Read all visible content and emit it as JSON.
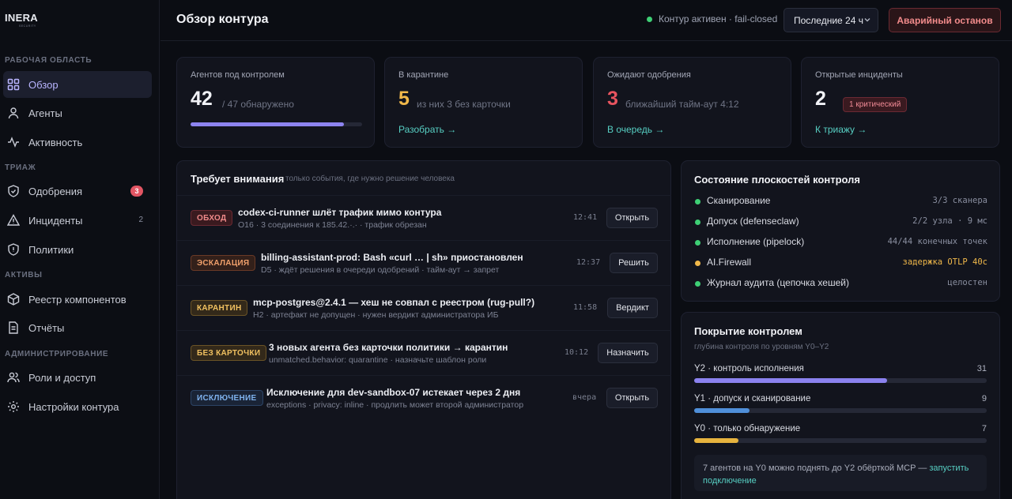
{
  "brand": {
    "name": "INERA",
    "sub": "SECURITY"
  },
  "sidebar": {
    "sections": [
      {
        "label": "РАБОЧАЯ ОБЛАСТЬ"
      },
      {
        "label": "ТРИАЖ"
      },
      {
        "label": "АКТИВЫ"
      },
      {
        "label": "АДМИНИСТРИРОВАНИЕ"
      }
    ],
    "items": [
      {
        "label": "Обзор",
        "icon": "grid-icon"
      },
      {
        "label": "Агенты",
        "icon": "user-icon"
      },
      {
        "label": "Активность",
        "icon": "pulse-icon"
      },
      {
        "label": "Одобрения",
        "icon": "shield-check-icon",
        "badge": "3"
      },
      {
        "label": "Инциденты",
        "icon": "warning-icon",
        "count": "2"
      },
      {
        "label": "Политики",
        "icon": "shield-icon"
      },
      {
        "label": "Реестр компонентов",
        "icon": "cube-icon"
      },
      {
        "label": "Отчёты",
        "icon": "document-icon"
      },
      {
        "label": "Роли и доступ",
        "icon": "users-icon"
      },
      {
        "label": "Настройки контура",
        "icon": "gear-icon"
      }
    ]
  },
  "header": {
    "title": "Обзор контура",
    "status": "Контур активен · fail-closed",
    "range": "Последние 24 ч",
    "stop_label": "Аварийный останов"
  },
  "stats": [
    {
      "label": "Агентов под контролем",
      "value": "42",
      "sub": "/ 47 обнаружено",
      "progress": 0.894,
      "color": "#f1f2f6"
    },
    {
      "label": "В карантине",
      "value": "5",
      "sub": "из них 3 без карточки",
      "link": "Разобрать →",
      "color": "#f0b84a"
    },
    {
      "label": "Ожидают одобрения",
      "value": "3",
      "sub": "ближайший тайм-аут 4:12",
      "link": "В очередь →",
      "color": "#e8545f"
    },
    {
      "label": "Открытые инциденты",
      "value": "2",
      "badge": "1 критический",
      "link": "К триажу →",
      "color": "#f1f2f6"
    }
  ],
  "attention": {
    "title": "Требует внимания",
    "subtitle": "только события, где нужно решение человека",
    "rows": [
      {
        "tag": "ОБХОД",
        "title": "codex-ci-runner шлёт трафик мимо контура",
        "desc": "O16 · 3 соединения к 185.42.·.· · трафик обрезан",
        "time": "12:41",
        "action": "Открыть"
      },
      {
        "tag": "ЭСКАЛАЦИЯ",
        "title": "billing-assistant-prod: Bash «curl … | sh» приостановлен",
        "desc": "D5 · ждёт решения в очереди одобрений · тайм-аут → запрет",
        "time": "12:37",
        "action": "Решить"
      },
      {
        "tag": "КАРАНТИН",
        "title": "mcp-postgres@2.4.1 — хеш не совпал с реестром (rug-pull?)",
        "desc": "H2 · артефакт не допущен · нужен вердикт администратора ИБ",
        "time": "11:58",
        "action": "Вердикт"
      },
      {
        "tag": "БЕЗ КАРТОЧКИ",
        "title": "3 новых агента без карточки политики → карантин",
        "desc": "unmatched.behavior: quarantine · назначьте шаблон роли",
        "time": "10:12",
        "action": "Назначить"
      },
      {
        "tag": "ИСКЛЮЧЕНИЕ",
        "title": "Исключение для dev-sandbox-07 истекает через 2 дня",
        "desc": "exceptions · privacy: inline · продлить может второй администратор",
        "time": "вчера",
        "action": "Открыть"
      }
    ]
  },
  "planes": {
    "title": "Состояние плоскостей контроля",
    "rows": [
      {
        "name": "Сканирование",
        "value": "3/3 сканера",
        "status": "ok"
      },
      {
        "name": "Допуск (defenseclaw)",
        "value": "2/2 узла · 9 мс",
        "status": "ok"
      },
      {
        "name": "Исполнение (pipelock)",
        "value": "44/44 конечных точек",
        "status": "ok"
      },
      {
        "name": "AI.Firewall",
        "value": "задержка OTLP 40с",
        "status": "warn"
      },
      {
        "name": "Журнал аудита (цепочка хешей)",
        "value": "целостен",
        "status": "ok"
      }
    ]
  },
  "coverage": {
    "title": "Покрытие контролем",
    "subtitle": "глубина контроля по уровням Y0–Y2",
    "rows": [
      {
        "name": "Y2 · контроль исполнения",
        "value": "31",
        "fraction": 0.66,
        "color": "#8b82ef"
      },
      {
        "name": "Y1 · допуск и сканирование",
        "value": "9",
        "fraction": 0.19,
        "color": "#4f8fd9"
      },
      {
        "name": "Y0 · только обнаружение",
        "value": "7",
        "fraction": 0.15,
        "color": "#e6b33e"
      }
    ],
    "note": "7 агентов на Y0 можно поднять до Y2 обёрткой MCP —",
    "note_link": "запустить подключение"
  }
}
